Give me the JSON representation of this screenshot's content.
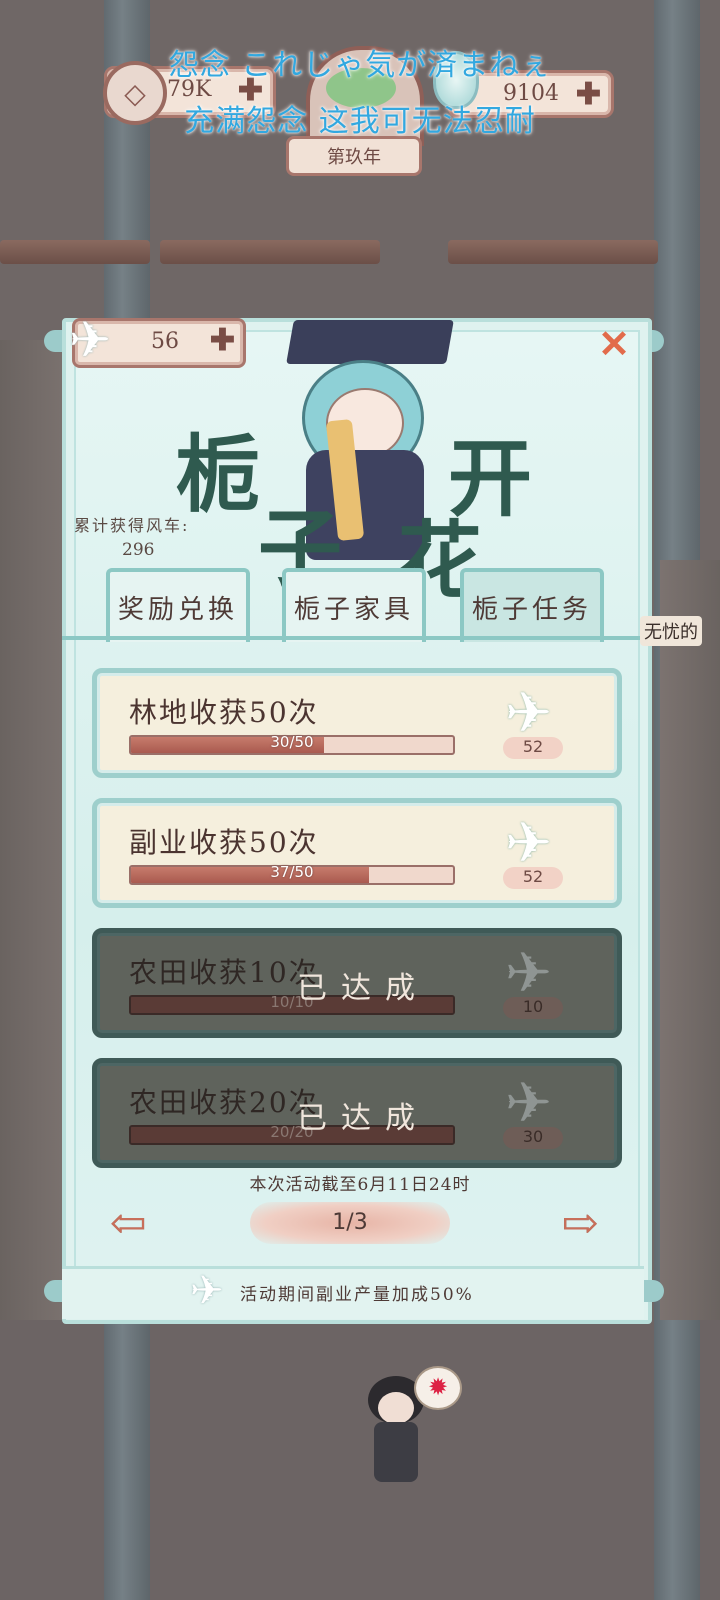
{
  "hud": {
    "coins": "79K",
    "gems": "9104",
    "year": "第玖年",
    "plus_glyph": "✚",
    "coin_glyph": "◇"
  },
  "captions": {
    "line1": "怨念 これじゃ気が済まねぇ",
    "line2": "充满怨念 这我可无法忍耐"
  },
  "panel": {
    "plane_count": "56",
    "close_glyph": "✕",
    "title_chars": [
      "栀",
      "子",
      "开",
      "花"
    ],
    "cumulative_label": "累计获得风车:",
    "cumulative_value": "296",
    "tabs": [
      {
        "label": "奖励兑换",
        "active": false
      },
      {
        "label": "栀子家具",
        "active": false
      },
      {
        "label": "栀子任务",
        "active": true
      }
    ],
    "tasks": [
      {
        "name": "林地收获50次",
        "progress_text": "30/50",
        "progress": 0.6,
        "reward": "52",
        "done": false
      },
      {
        "name": "副业收获50次",
        "progress_text": "37/50",
        "progress": 0.74,
        "reward": "52",
        "done": false
      },
      {
        "name": "农田收获10次",
        "progress_text": "10/10",
        "progress": 1.0,
        "reward": "10",
        "done": true
      },
      {
        "name": "农田收获20次",
        "progress_text": "20/20",
        "progress": 1.0,
        "reward": "30",
        "done": true
      }
    ],
    "done_label": "已达成",
    "deadline": "本次活动截至6月11日24时",
    "page": "1/3",
    "prev_glyph": "⇦",
    "next_glyph": "⇨",
    "bonus_text": "活动期间副业产量加成50%",
    "plane_glyph": "✈"
  },
  "side_text": "无忧的",
  "anger_glyph": "✹"
}
